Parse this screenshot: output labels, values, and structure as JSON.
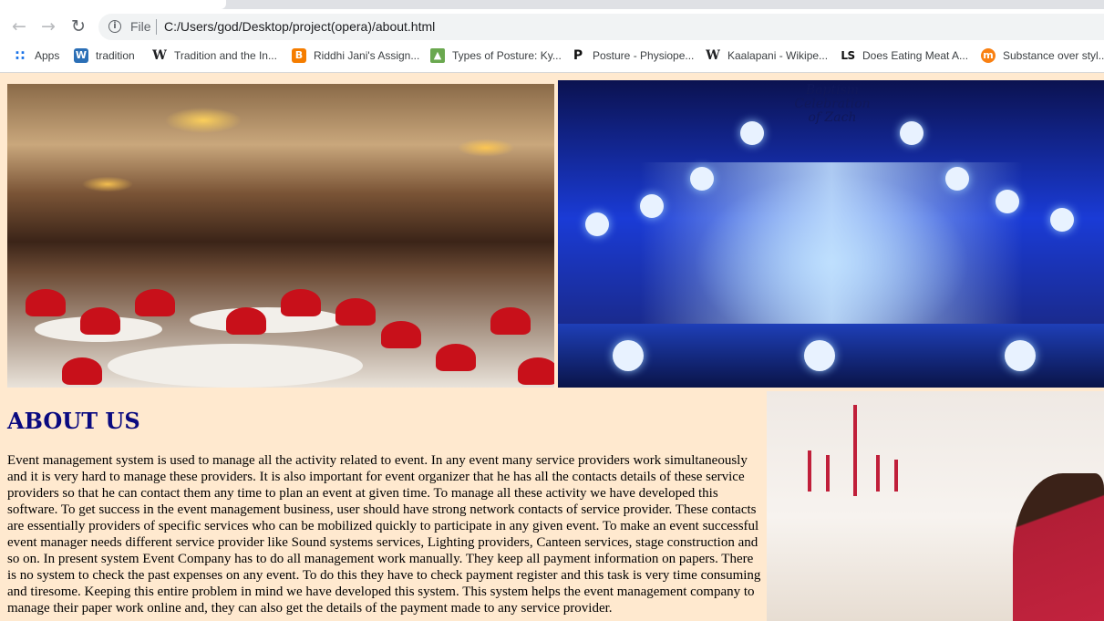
{
  "browser": {
    "scheme_label": "File",
    "url": "C:/Users/god/Desktop/project(opera)/about.html",
    "bookmarks": [
      {
        "label": "Apps",
        "icon": "apps-grid-icon"
      },
      {
        "label": "tradition",
        "icon": "word-icon"
      },
      {
        "label": "Tradition and the In...",
        "icon": "wikipedia-icon"
      },
      {
        "label": "Riddhi Jani's Assign...",
        "icon": "blogger-icon"
      },
      {
        "label": "Types of Posture: Ky...",
        "icon": "image-site-icon"
      },
      {
        "label": "Posture - Physiope...",
        "icon": "physiopedia-icon"
      },
      {
        "label": "Kaalapani - Wikipe...",
        "icon": "wikipedia-icon"
      },
      {
        "label": "Does Eating Meat A...",
        "icon": "ls-icon"
      },
      {
        "label": "Substance over styl...",
        "icon": "moodle-icon"
      }
    ]
  },
  "images": {
    "stage_banner_text": "Baptism Celebration of Zach"
  },
  "about": {
    "heading": "ABOUT US",
    "paragraph": "Event management system is used to manage all the activity related to event. In any event many service providers work simultaneously and it is very hard to manage these providers. It is also important for event organizer that he has all the contacts details of these service providers so that he can contact them any time to plan an event at given time. To manage all these activity we have developed this software. To get success in the event management business, user should have strong network contacts of service provider. These contacts are essentially providers of specific services who can be mobilized quickly to participate in any given event. To make an event successful event manager needs different service provider like Sound systems services, Lighting providers, Canteen services, stage construction and so on. In present system Event Company has to do all management work manually. They keep all payment information on papers. There is no system to check the past expenses on any event. To do this they have to check payment register and this task is very time consuming and tiresome. Keeping this entire problem in mind we have developed this system. This system helps the event management company to manage their paper work online and, they can also get the details of the payment made to any service provider."
  }
}
